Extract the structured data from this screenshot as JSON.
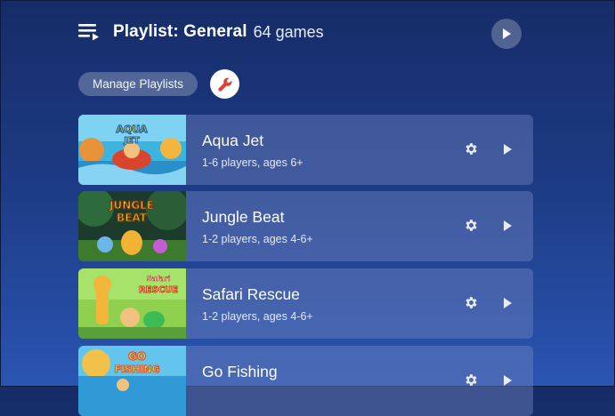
{
  "header": {
    "title": "Playlist: General",
    "count": "64 games",
    "play_all_icon": "play-icon",
    "menu_icon": "playlist-icon"
  },
  "controls": {
    "manage_label": "Manage Playlists",
    "wrench_icon": "wrench-icon",
    "wrench_color": "#e0403a"
  },
  "games": [
    {
      "name": "Aqua Jet",
      "meta": "1-6 players, ages 6+",
      "thumb_text": [
        "AQUA",
        "JET"
      ]
    },
    {
      "name": "Jungle Beat",
      "meta": "1-2 players, ages 4-6+",
      "thumb_text": [
        "JUNGLE",
        "BEAT"
      ]
    },
    {
      "name": "Safari Rescue",
      "meta": "1-2 players, ages 4-6+",
      "thumb_text": [
        "Safari",
        "RESCUE"
      ]
    },
    {
      "name": "Go Fishing",
      "meta": "",
      "thumb_text": [
        "GO",
        "FISHING"
      ]
    }
  ]
}
